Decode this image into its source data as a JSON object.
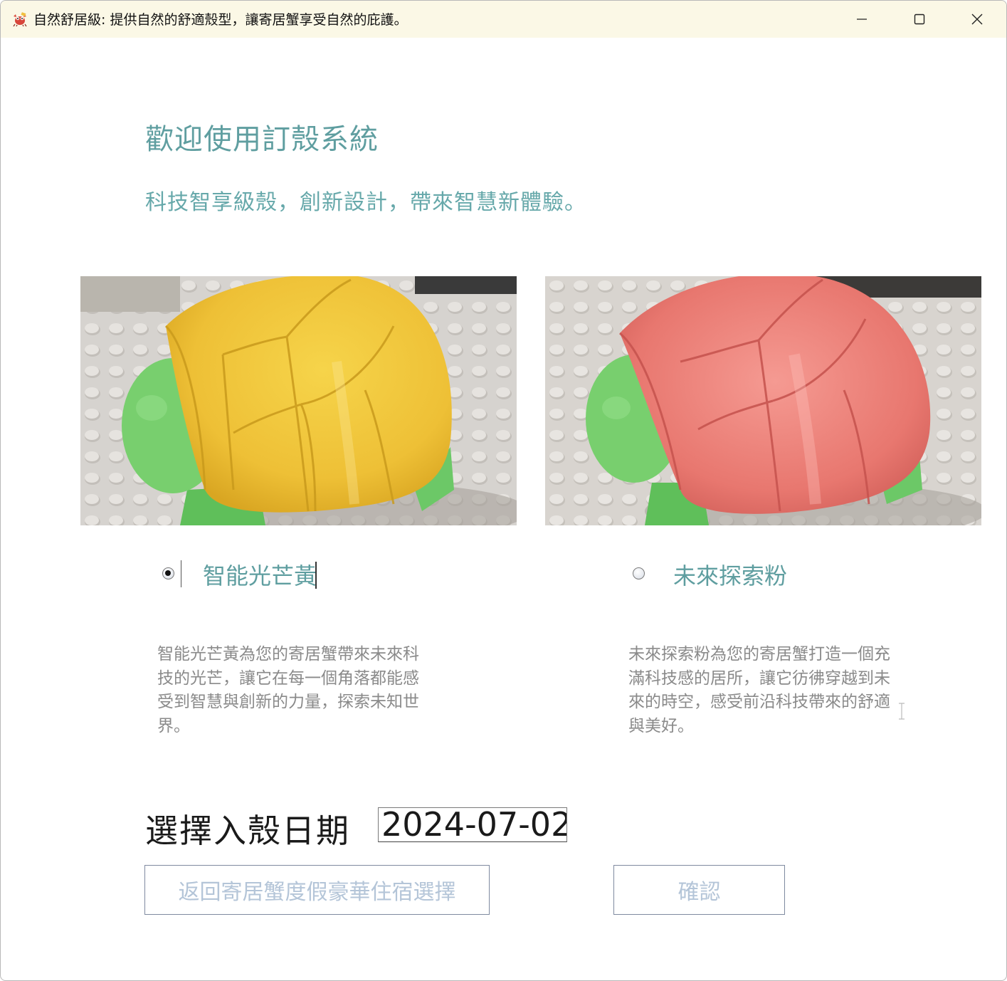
{
  "window": {
    "title": "自然舒居級: 提供自然的舒適殼型，讓寄居蟹享受自然的庇護。",
    "app_icon": "crab-mascot-icon",
    "controls": {
      "minimize": "minimize-icon",
      "maximize": "maximize-icon",
      "close": "close-icon"
    }
  },
  "main": {
    "heading": "歡迎使用訂殼系統",
    "subheading": "科技智享級殼，創新設計，帶來智慧新體驗。"
  },
  "options": [
    {
      "id": "yellow",
      "label": "智能光芒黃",
      "selected": true,
      "image": "yellow-3d-printed-shell-on-green-crab-toy",
      "color": "#f2c230",
      "description": "智能光芒黃為您的寄居蟹帶來未來科技的光芒，讓它在每一個角落都能感受到智慧與創新的力量，探索未知世界。"
    },
    {
      "id": "pink",
      "label": "未來探索粉",
      "selected": false,
      "image": "pink-3d-printed-shell-on-green-crab-toy",
      "color": "#e87a72",
      "description": "未來探索粉為您的寄居蟹打造一個充滿科技感的居所，讓它彷彿穿越到未來的時空，感受前沿科技帶來的舒適與美好。"
    }
  ],
  "date": {
    "label": "選擇入殼日期",
    "value": "2024-07-02"
  },
  "buttons": {
    "back": "返回寄居蟹度假豪華住宿選擇",
    "confirm": "確認"
  },
  "colors": {
    "accent_teal": "#5f9ea0",
    "titlebar_bg": "#fbf8e6",
    "disabled_text": "#b4c5d8"
  }
}
